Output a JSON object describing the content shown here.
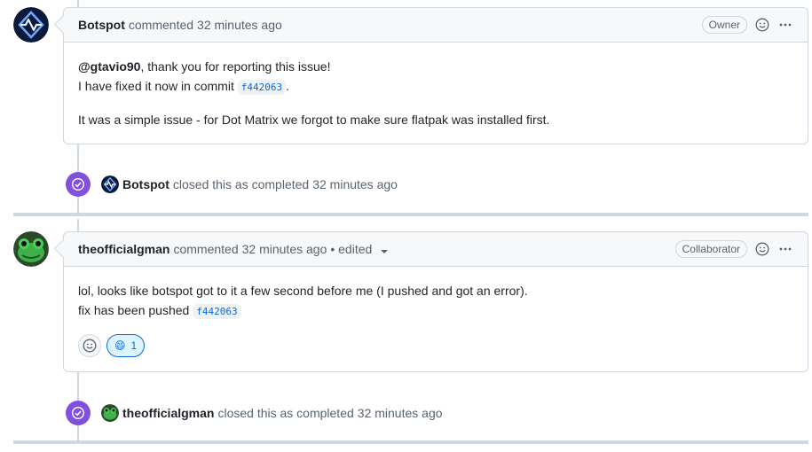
{
  "comments": [
    {
      "author": "Botspot",
      "action": "commented",
      "time": "32 minutes ago",
      "role": "Owner",
      "body": {
        "mention": "@gtavio90",
        "line1_rest": ", thank you for reporting this issue!",
        "line2_prefix": "I have fixed it now in commit",
        "commit": "f442063",
        "line2_suffix": ".",
        "line3": "It was a simple issue - for Dot Matrix we forgot to make sure flatpak was installed first."
      }
    },
    {
      "author": "theofficialgman",
      "action": "commented",
      "time": "32 minutes ago",
      "edited": "• edited",
      "role": "Collaborator",
      "body": {
        "line1": "lol, looks like botspot got to it a few second before me (I pushed and got an error).",
        "line2_prefix": "fix has been pushed",
        "commit": "f442063"
      },
      "reaction": {
        "emoji": "😄",
        "count": "1"
      }
    }
  ],
  "events": [
    {
      "author": "Botspot",
      "text": "closed this as completed",
      "time": "32 minutes ago"
    },
    {
      "author": "theofficialgman",
      "text": "closed this as completed",
      "time": "32 minutes ago"
    }
  ],
  "colors": {
    "closed_badge": "#8250df",
    "link": "#0969da",
    "border": "#d0d7de",
    "header_bg": "#f6f8fa"
  },
  "icons": [
    "botspot-avatar",
    "frog-avatar",
    "smiley-icon",
    "kebab-icon",
    "check-circle-icon",
    "caret-down-icon"
  ]
}
